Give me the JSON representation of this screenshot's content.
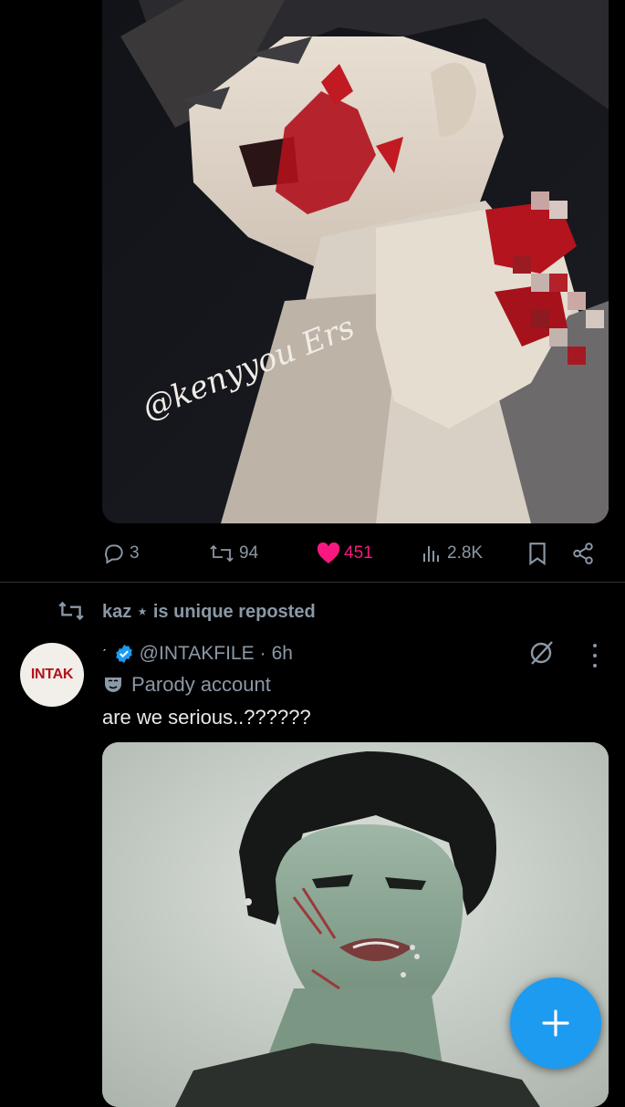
{
  "post1": {
    "image_alt_icon": "illustration-artwork",
    "watermark_text": "@kenyyou Ers",
    "actions": {
      "replies": "3",
      "reposts": "94",
      "likes": "451",
      "views": "2.8K"
    }
  },
  "repost_line": {
    "label": "kaz ⋆ is unique reposted",
    "icon": "repost-icon"
  },
  "post2": {
    "avatar_text": "INTAK",
    "mark": "ˊ",
    "handle": "@INTAKFILE",
    "separator": "·",
    "time": "6h",
    "badge": "Parody account",
    "text": "are we serious..??????",
    "image_alt_icon": "photo"
  },
  "fab": {
    "icon": "plus-icon"
  },
  "colors": {
    "background": "#000000",
    "muted": "#8b98a5",
    "like": "#f91880",
    "accent": "#1d9bf0",
    "verified": "#1d9bf0"
  }
}
